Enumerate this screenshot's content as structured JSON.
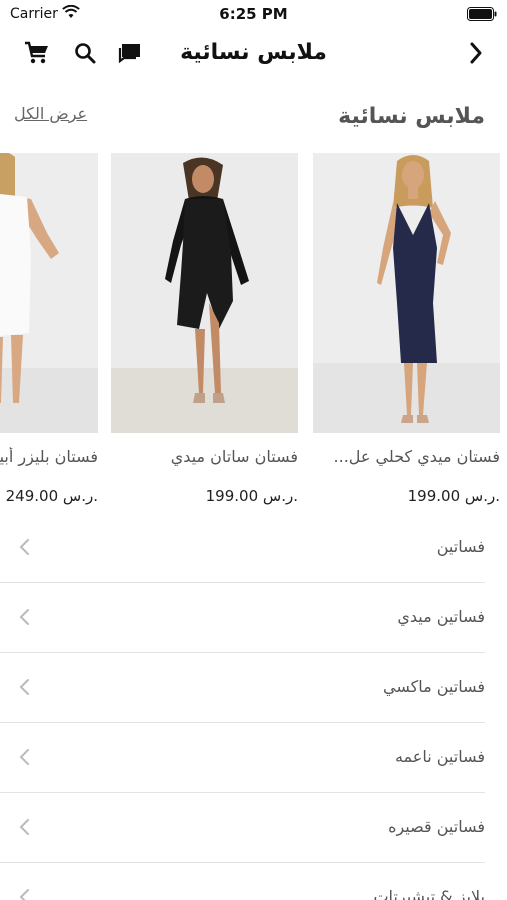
{
  "status": {
    "carrier": "Carrier",
    "time": "6:25 PM"
  },
  "nav": {
    "title": "ملابس نسائية"
  },
  "section": {
    "title": "ملابس نسائية",
    "view_all": "عرض الكل"
  },
  "products": [
    {
      "name": "فستان ميدي كحلي عل...",
      "price": "199.00 ر.س."
    },
    {
      "name": "فستان ساتان ميدي",
      "price": "199.00 ر.س."
    },
    {
      "name": "فستان بليزر أبيض",
      "price": "249.00 ر.س."
    }
  ],
  "categories": [
    {
      "label": "فساتين"
    },
    {
      "label": "فساتين ميدي"
    },
    {
      "label": "فساتين ماكسي"
    },
    {
      "label": "فساتين ناعمه"
    },
    {
      "label": "فساتين قصيره"
    },
    {
      "label": "بلايز & تيشيرتات"
    }
  ],
  "colors": {
    "image_bg": "#ededed",
    "divider": "#e3e3e3",
    "text_gray": "#555555"
  }
}
